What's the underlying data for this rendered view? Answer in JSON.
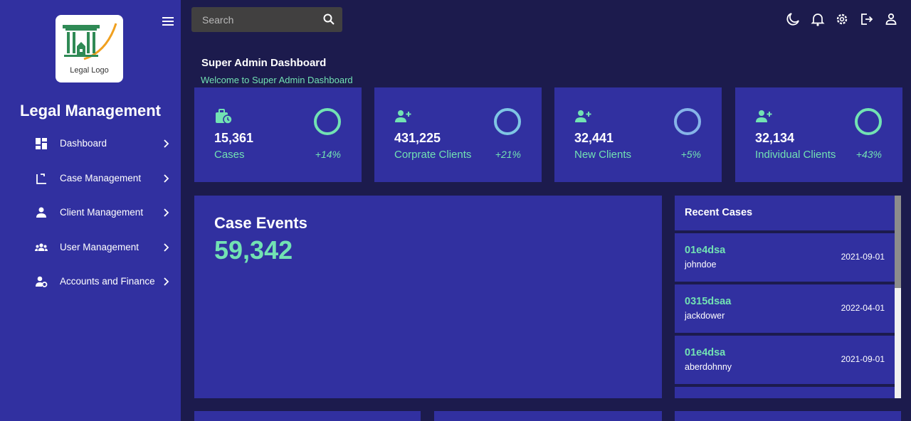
{
  "brand": {
    "logo_text": "Legal Logo",
    "app_title": "Legal Management"
  },
  "sidebar": {
    "items": [
      {
        "label": "Dashboard",
        "icon": "dashboard-icon"
      },
      {
        "label": "Case Management",
        "icon": "case-icon"
      },
      {
        "label": "Client Management",
        "icon": "person-icon"
      },
      {
        "label": "User Management",
        "icon": "group-icon"
      },
      {
        "label": "Accounts and Finance",
        "icon": "user-settings-icon"
      }
    ]
  },
  "topbar": {
    "search_placeholder": "Search",
    "icons": [
      "moon-icon",
      "bell-icon",
      "gear-icon",
      "logout-icon",
      "user-icon"
    ]
  },
  "page": {
    "title": "Super Admin Dashboard",
    "subtitle": "Welcome to Super Admin Dashboard"
  },
  "stats": [
    {
      "value": "15,361",
      "label": "Cases",
      "change": "+14%",
      "icon": "briefcase-clock-icon"
    },
    {
      "value": "431,225",
      "label": "Corprate Clients",
      "change": "+21%",
      "icon": "person-add-icon"
    },
    {
      "value": "32,441",
      "label": "New Clients",
      "change": "+5%",
      "icon": "person-add-icon"
    },
    {
      "value": "32,134",
      "label": "Individual Clients",
      "change": "+43%",
      "icon": "person-add-icon"
    }
  ],
  "case_events": {
    "title": "Case Events",
    "value": "59,342"
  },
  "recent_cases": {
    "title": "Recent Cases",
    "items": [
      {
        "id": "01e4dsa",
        "user": "johndoe",
        "date": "2021-09-01"
      },
      {
        "id": "0315dsaa",
        "user": "jackdower",
        "date": "2022-04-01"
      },
      {
        "id": "01e4dsa",
        "user": "aberdohnny",
        "date": "2021-09-01"
      }
    ]
  },
  "colors": {
    "background": "#1c1b4d",
    "card": "#3130a0",
    "accent": "#72e2b3",
    "search_bg": "#414040"
  }
}
